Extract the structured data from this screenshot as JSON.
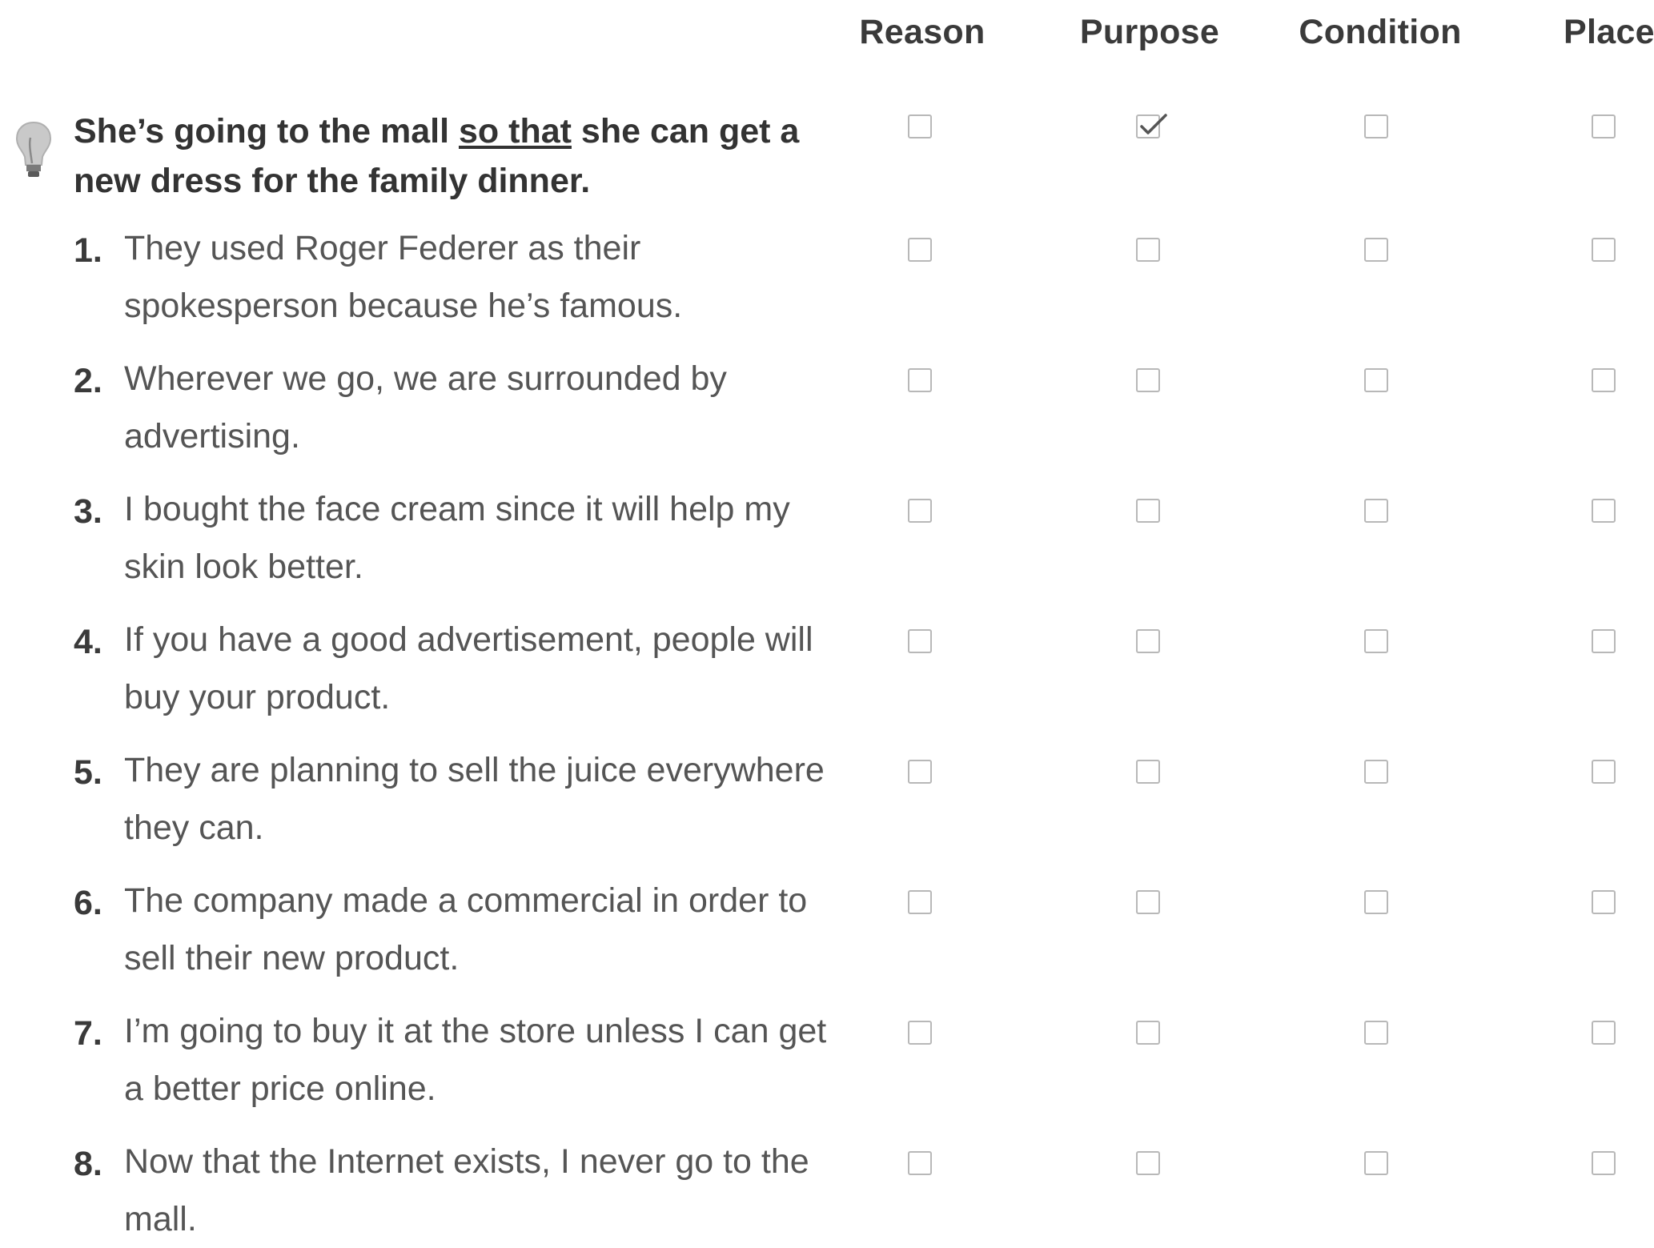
{
  "columns": [
    "Reason",
    "Purpose",
    "Condition",
    "Place"
  ],
  "example": {
    "before": "She’s going to the mall ",
    "underlined": "so that",
    "after": " she can get a new dress for the family dinner.",
    "checked_column": "Purpose"
  },
  "items": [
    {
      "number": "1.",
      "text": "They used Roger Federer as their spokesperson because he’s famous."
    },
    {
      "number": "2.",
      "text": "Wherever we go, we are surrounded by advertising."
    },
    {
      "number": "3.",
      "text": "I bought the face cream since it will help my skin look better."
    },
    {
      "number": "4.",
      "text": "If you have a good advertisement, people will buy your product."
    },
    {
      "number": "5.",
      "text": "They are planning to sell the juice everywhere they can."
    },
    {
      "number": "6.",
      "text": "The company made a commercial in order to sell their new product."
    },
    {
      "number": "7.",
      "text": "I’m going to buy it at the store unless I can get a better price online."
    },
    {
      "number": "8.",
      "text": "Now that the Internet exists, I never go to the mall."
    }
  ],
  "icons": {
    "tip": "lightbulb-icon",
    "check": "checkmark-icon"
  }
}
